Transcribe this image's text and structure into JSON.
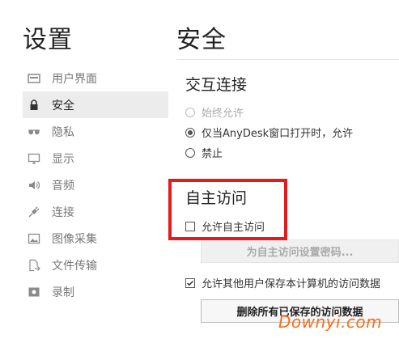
{
  "sidebar": {
    "title": "设置",
    "items": [
      {
        "label": "用户界面",
        "icon": "monitor-window-icon",
        "active": false
      },
      {
        "label": "安全",
        "icon": "lock-icon",
        "active": true
      },
      {
        "label": "隐私",
        "icon": "sunglasses-icon",
        "active": false
      },
      {
        "label": "显示",
        "icon": "display-icon",
        "active": false
      },
      {
        "label": "音频",
        "icon": "speaker-icon",
        "active": false
      },
      {
        "label": "连接",
        "icon": "plug-icon",
        "active": false
      },
      {
        "label": "图像采集",
        "icon": "image-icon",
        "active": false
      },
      {
        "label": "文件传输",
        "icon": "file-transfer-icon",
        "active": false
      },
      {
        "label": "录制",
        "icon": "record-icon",
        "active": false
      }
    ]
  },
  "main": {
    "title": "安全",
    "interactive_access": {
      "title": "交互连接",
      "options": [
        {
          "label": "始终允许",
          "checked": false,
          "disabled": true
        },
        {
          "label": "仅当AnyDesk窗口打开时，允许",
          "checked": true,
          "disabled": false
        },
        {
          "label": "禁止",
          "checked": false,
          "disabled": false
        }
      ]
    },
    "unattended_access": {
      "title": "自主访问",
      "enable_label": "允许自主访问",
      "enable_checked": false,
      "set_password_button": "为自主访问设置密码...",
      "allow_others_label": "允许其他用户保存本计算机的访问数据",
      "allow_others_checked": true,
      "delete_button": "删除所有已保存的访问数据"
    }
  },
  "watermark": "Downyi.com",
  "colors": {
    "highlight": "#e31b1b",
    "watermark": "#ff6a13"
  }
}
